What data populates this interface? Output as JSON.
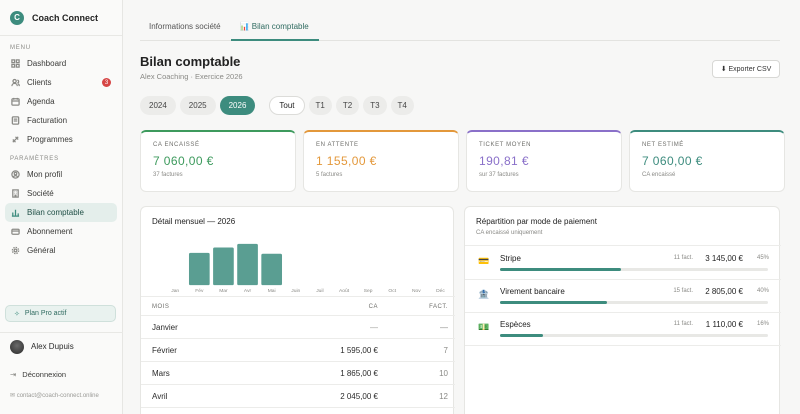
{
  "brand": {
    "logo_letter": "C",
    "name": "Coach Connect"
  },
  "sidebar": {
    "menu_label": "MENU",
    "menu_items": [
      {
        "label": "Dashboard",
        "icon": "grid-icon"
      },
      {
        "label": "Clients",
        "icon": "users-icon",
        "badge": "3"
      },
      {
        "label": "Agenda",
        "icon": "calendar-icon"
      },
      {
        "label": "Facturation",
        "icon": "invoice-icon"
      },
      {
        "label": "Programmes",
        "icon": "programs-icon"
      }
    ],
    "settings_label": "PARAMÈTRES",
    "settings_items": [
      {
        "label": "Mon profil",
        "icon": "user-circle-icon"
      },
      {
        "label": "Société",
        "icon": "building-icon"
      },
      {
        "label": "Bilan comptable",
        "icon": "bar-chart-icon",
        "active": true
      },
      {
        "label": "Abonnement",
        "icon": "card-icon"
      },
      {
        "label": "Général",
        "icon": "gear-icon"
      }
    ],
    "plan": "Plan Pro actif",
    "user_name": "Alex Dupuis",
    "logout": "Déconnexion",
    "contact": "contact@coach-connect.online"
  },
  "tabs": [
    {
      "label": "Informations société",
      "active": false
    },
    {
      "label": "📊 Bilan comptable",
      "active": true
    }
  ],
  "header": {
    "title": "Bilan comptable",
    "subtitle": "Alex Coaching · Exercice 2026",
    "export_label": "⬇ Exporter CSV"
  },
  "years": [
    {
      "label": "2024"
    },
    {
      "label": "2025"
    },
    {
      "label": "2026",
      "active": true
    }
  ],
  "periods": [
    {
      "label": "Tout",
      "active": true
    },
    {
      "label": "T1"
    },
    {
      "label": "T2"
    },
    {
      "label": "T3"
    },
    {
      "label": "T4"
    }
  ],
  "kpis": [
    {
      "label": "CA encaissé",
      "value": "7 060,00 €",
      "note": "37 factures",
      "color": "#3d9a5d"
    },
    {
      "label": "En attente",
      "value": "1 155,00 €",
      "note": "5 factures",
      "color": "#e3983b"
    },
    {
      "label": "Ticket moyen",
      "value": "190,81 €",
      "note": "sur 37 factures",
      "color": "#8a70c9"
    },
    {
      "label": "Net estimé",
      "value": "7 060,00 €",
      "note": "CA encaissé",
      "color": "#3d8c7e"
    }
  ],
  "monthly": {
    "title": "Détail mensuel — 2026",
    "col_month": "MOIS",
    "col_ca": "CA",
    "col_fact": "FACT.",
    "rows": [
      {
        "month": "Janvier",
        "ca": "—",
        "fact": "—"
      },
      {
        "month": "Février",
        "ca": "1 595,00 €",
        "fact": "7"
      },
      {
        "month": "Mars",
        "ca": "1 865,00 €",
        "fact": "10"
      },
      {
        "month": "Avril",
        "ca": "2 045,00 €",
        "fact": "12"
      }
    ]
  },
  "chart_data": {
    "type": "bar",
    "categories": [
      "Jan",
      "Fév",
      "Mar",
      "Avr",
      "Mai",
      "Juin",
      "Juil",
      "Août",
      "Sep",
      "Oct",
      "Nov",
      "Déc"
    ],
    "values": [
      0,
      1595,
      1865,
      2045,
      1555,
      0,
      0,
      0,
      0,
      0,
      0,
      0
    ],
    "title": "",
    "xlabel": "",
    "ylabel": "",
    "color": "#5a9e92"
  },
  "payments": {
    "title": "Répartition par mode de paiement",
    "subtitle": "CA encaissé uniquement",
    "items": [
      {
        "name": "Stripe",
        "icon": "💳",
        "count": "11 fact.",
        "amount": "3 145,00 €",
        "pct": "45%",
        "share": 0.45
      },
      {
        "name": "Virement bancaire",
        "icon": "🏦",
        "count": "15 fact.",
        "amount": "2 805,00 €",
        "pct": "40%",
        "share": 0.4
      },
      {
        "name": "Espèces",
        "icon": "💵",
        "count": "11 fact.",
        "amount": "1 110,00 €",
        "pct": "16%",
        "share": 0.16
      }
    ]
  }
}
